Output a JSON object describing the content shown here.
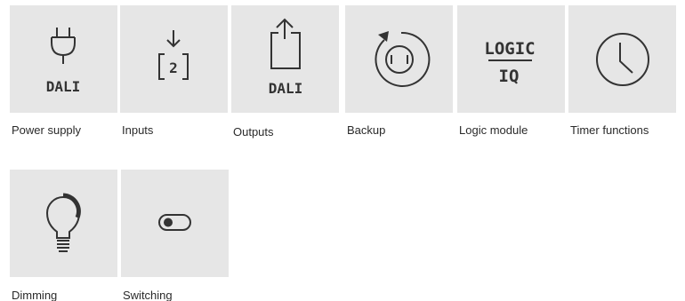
{
  "tiles": [
    {
      "label": "Power supply",
      "icon": "power-plug-icon",
      "caption": "DALI"
    },
    {
      "label": "Inputs",
      "icon": "input-arrow-icon",
      "caption": "2"
    },
    {
      "label": "Outputs",
      "icon": "output-arrow-icon",
      "caption": "DALI"
    },
    {
      "label": "Backup",
      "icon": "backup-cycle-icon",
      "caption": ""
    },
    {
      "label": "Logic module",
      "icon": "logic-iq-icon",
      "caption_top": "LOGIC",
      "caption_bottom": "IQ"
    },
    {
      "label": "Timer functions",
      "icon": "clock-icon",
      "caption": ""
    },
    {
      "label": "Dimming",
      "icon": "light-bulb-icon",
      "caption": ""
    },
    {
      "label": "Switching",
      "icon": "toggle-switch-icon",
      "caption": ""
    }
  ],
  "colors": {
    "tile_background": "#e6e6e6",
    "icon_stroke": "#333333",
    "label_text": "#2a2a2a"
  }
}
